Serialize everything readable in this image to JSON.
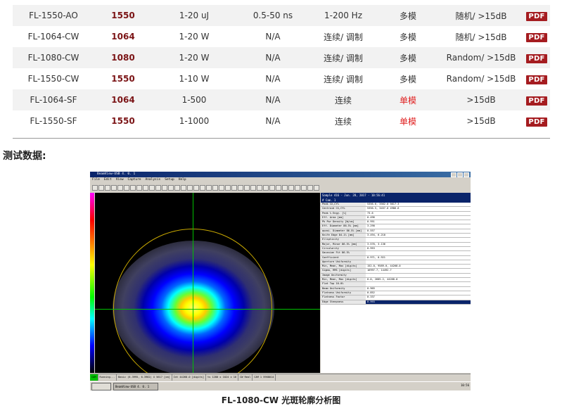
{
  "products": [
    {
      "model": "FL-1550-AO",
      "wavelength": "1550",
      "power": "1-20 uJ",
      "pulse": "0.5-50 ns",
      "rep": "1-200 Hz",
      "mode": "多模",
      "single": false,
      "isolation": "随机/ >15dB",
      "pdf": "PDF"
    },
    {
      "model": "FL-1064-CW",
      "wavelength": "1064",
      "power": "1-20 W",
      "pulse": "N/A",
      "rep": "连续/ 调制",
      "mode": "多模",
      "single": false,
      "isolation": "随机/ >15dB",
      "pdf": "PDF"
    },
    {
      "model": "FL-1080-CW",
      "wavelength": "1080",
      "power": "1-20 W",
      "pulse": "N/A",
      "rep": "连续/ 调制",
      "mode": "多模",
      "single": false,
      "isolation": "Random/ >15dB",
      "pdf": "PDF"
    },
    {
      "model": "FL-1550-CW",
      "wavelength": "1550",
      "power": "1-10 W",
      "pulse": "N/A",
      "rep": "连续/ 调制",
      "mode": "多模",
      "single": false,
      "isolation": "Random/ >15dB",
      "pdf": "PDF"
    },
    {
      "model": "FL-1064-SF",
      "wavelength": "1064",
      "power": "1-500",
      "pulse": "N/A",
      "rep": "连续",
      "mode": "单模",
      "single": true,
      "isolation": ">15dB",
      "pdf": "PDF"
    },
    {
      "model": "FL-1550-SF",
      "wavelength": "1550",
      "power": "1-1000",
      "pulse": "N/A",
      "rep": "连续",
      "mode": "单模",
      "single": true,
      "isolation": ">15dB",
      "pdf": "PDF"
    }
  ],
  "section_title": "测试数据:",
  "caption": "FL-1080-CW 光斑轮廓分析图",
  "screenshot": {
    "title": "BeamView-USB 4. 0. 1",
    "menu": [
      "File",
      "Edit",
      "View",
      "Capture",
      "Analysis",
      "Setup",
      "Help"
    ],
    "panel_header": "Sample 416  -  Jun. 28, 2017  -  10:56:41",
    "panel_sub": "#  Cam. 1",
    "rows": [
      {
        "k": "Peak CX,CY%",
        "v": "5356.6, 3562.0 5617.3"
      },
      {
        "k": "Centroid CX,CY%",
        "v": "5356.5, 3457.0 4986.6"
      },
      {
        "k": "Peak % Engy. [%]",
        "v": "73.6"
      },
      {
        "k": "Eff. Area [mm]",
        "v": "0.496"
      },
      {
        "k": "Pk Pwr Density [W/cm]",
        "v": "0.951"
      },
      {
        "k": "Eff. Diameter 86.5% [mm]",
        "v": "3.290"
      },
      {
        "k": "quasi. Diameter 86.5% [mm]",
        "v": "0.557"
      },
      {
        "k": "Knife Edge 84.1% [mm]",
        "v": "3.494, 6.210"
      },
      {
        "k": "Ellipticity",
        "v": ""
      },
      {
        "k": "Major, Minor 86.5% [mm]",
        "v": "3.576, 3.136"
      },
      {
        "k": "Circularity",
        "v": "0.953"
      },
      {
        "k": "Gaussian Fit 86.5%",
        "v": ""
      },
      {
        "k": "Coefficient",
        "v": "0.971, 0.921"
      },
      {
        "k": "Aperture Uniformity",
        "v": ""
      },
      {
        "k": "Min, Mean, Max [digits]",
        "v": "152.0, 9589.0, 44268.0"
      },
      {
        "k": "Sigma, RMS [digits]",
        "v": "16997.7, 14492.7"
      },
      {
        "k": "Image Uniformity",
        "v": ""
      },
      {
        "k": "Min, Mean, Max [digits]",
        "v": "0.0, 2605.2, 44268.0"
      },
      {
        "k": "Flat Top 10.0%",
        "v": ""
      },
      {
        "k": "Beam Uniformity",
        "v": "0.965"
      },
      {
        "k": "Flatness Uniformity",
        "v": "0.852"
      },
      {
        "k": "Flatness Factor",
        "v": "0.337"
      },
      {
        "k": "Edge Steepness",
        "v": "0.993"
      }
    ],
    "status": [
      "CAM",
      "Running...",
      "Basic (6.3995, 6.3962) X 5617 [cm]",
      "Int 44268.0 [digits]",
      "ts  1280 x 1024 x 16",
      "CW  Real",
      "CAM 1 5968014"
    ],
    "taskbar": [
      "BeamView-USB 4. 0. 1"
    ],
    "clock": "10:56"
  }
}
